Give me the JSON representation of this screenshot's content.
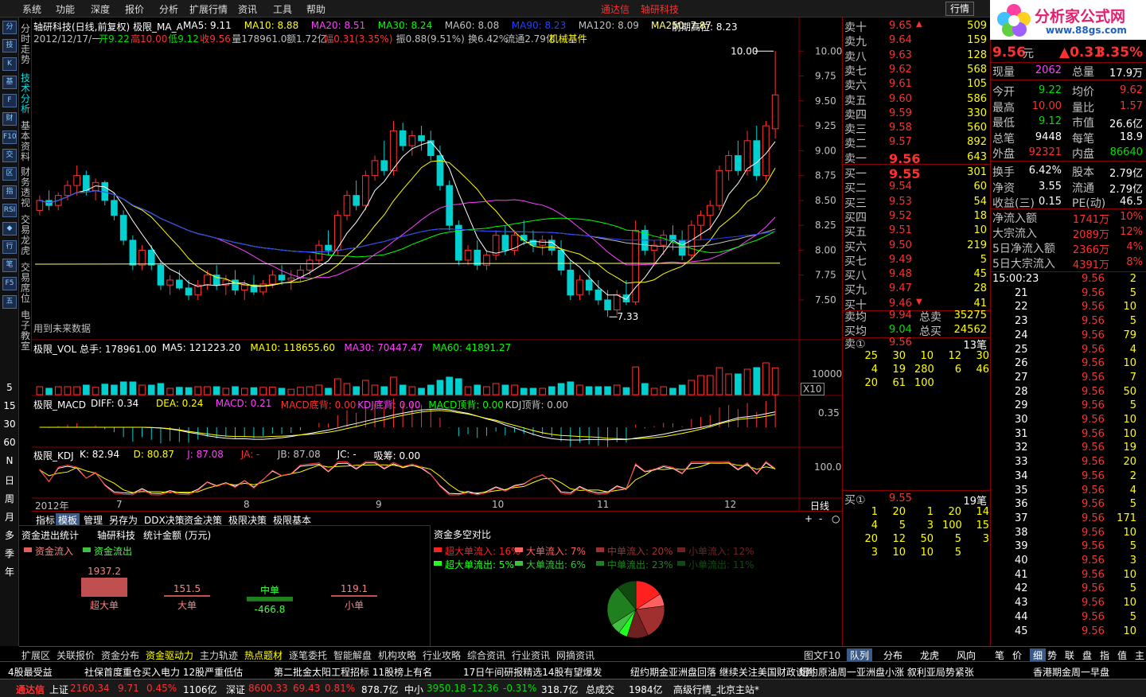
{
  "menu": [
    "系统",
    "功能",
    "深度",
    "报价",
    "分析",
    "扩展行情",
    "资讯",
    "工具",
    "帮助"
  ],
  "center_title": {
    "app": "通达信",
    "stock": "轴研科技"
  },
  "quote_button": "行情",
  "logo": {
    "main": "分析家公式网",
    "sub": "www.88gs.com"
  },
  "left_icons": [
    "分",
    "技",
    "K",
    "基",
    "F",
    "财",
    "F10",
    "交",
    "区",
    "指",
    "RSI",
    "◆",
    "行",
    "笔",
    "F5",
    "五"
  ],
  "left_periods": [
    "5",
    "15",
    "30",
    "60",
    "N",
    "日",
    "周",
    "月",
    "多",
    "季",
    "年"
  ],
  "vertical_tabs": [
    {
      "label": "分时走势",
      "active": false
    },
    {
      "label": "技术分析",
      "active": true
    },
    {
      "label": "基本资料",
      "active": false
    },
    {
      "label": "财务透视",
      "active": false
    },
    {
      "label": "交易龙虎",
      "active": false
    },
    {
      "label": "交易席位",
      "active": false
    },
    {
      "label": "电子教室",
      "active": false
    }
  ],
  "main_chart": {
    "title": "轴研科技(日线,前复权)",
    "indicator": "极限_MA_A",
    "ma": [
      {
        "label": "MA5: 9.11",
        "color": "#ffffff"
      },
      {
        "label": "MA10: 8.88",
        "color": "#ffff00"
      },
      {
        "label": "MA20: 8.51",
        "color": "#ff40ff"
      },
      {
        "label": "MA30: 8.24",
        "color": "#00ff00"
      },
      {
        "label": "MA60: 8.08",
        "color": "#c0c0c0"
      },
      {
        "label": "MA90: 8.23",
        "color": "#2040ff"
      },
      {
        "label": "MA120: 8.09",
        "color": "#c0c0c0"
      },
      {
        "label": "MA250: 7.87",
        "color": "#ffff80"
      }
    ],
    "prev_high": "前期高位: 8.23",
    "info_date": "2012/12/17/一",
    "info_items": [
      {
        "t": "开9.22",
        "c": "#00e000"
      },
      {
        "t": "高10.00",
        "c": "#ff3030"
      },
      {
        "t": "低9.12",
        "c": "#00e000"
      },
      {
        "t": "收9.56",
        "c": "#ff3030"
      },
      {
        "t": "量178961.0",
        "c": "#c0c0c0"
      },
      {
        "t": "额1.72亿",
        "c": "#c0c0c0"
      },
      {
        "t": "幅0.31(3.35%)",
        "c": "#ff3030"
      },
      {
        "t": "振0.88(9.51%)",
        "c": "#c0c0c0"
      },
      {
        "t": "换6.42%",
        "c": "#c0c0c0"
      },
      {
        "t": "流通2.79亿",
        "c": "#c0c0c0"
      },
      {
        "t": "机械基件",
        "c": "#ffff00"
      }
    ],
    "price_ticks": [
      "10.00",
      "9.75",
      "9.50",
      "9.25",
      "9.00",
      "8.75",
      "8.50",
      "8.25",
      "8.00",
      "7.75",
      "7.50"
    ],
    "high_label": "10.00",
    "low_label": "7.33",
    "future_label": "用到未来数据"
  },
  "volume_chart": {
    "indicator": "极限_VOL",
    "items": [
      {
        "t": "总手: 178961.00",
        "c": "#ffffff"
      },
      {
        "t": "MA5: 121223.20",
        "c": "#ffffff"
      },
      {
        "t": "MA10: 118655.60",
        "c": "#ffff00"
      },
      {
        "t": "MA30: 70447.47",
        "c": "#ff40ff"
      },
      {
        "t": "MA60: 41891.27",
        "c": "#00ff00"
      }
    ],
    "tick": "10000",
    "scale": "X10"
  },
  "macd_chart": {
    "indicator": "极限_MACD",
    "items": [
      {
        "t": "DIFF: 0.34",
        "c": "#ffffff"
      },
      {
        "t": "DEA: 0.24",
        "c": "#ffff00"
      },
      {
        "t": "MACD: 0.21",
        "c": "#ff40ff"
      },
      {
        "t": "MACD底背: 0.00",
        "c": "#ff3030"
      },
      {
        "t": "KDJ底背: 0.00",
        "c": "#ff40ff"
      },
      {
        "t": "MACD顶背: 0.00",
        "c": "#00ff00"
      },
      {
        "t": "KDJ顶背: 0.00",
        "c": "#c0c0c0"
      }
    ],
    "tick": "0.35"
  },
  "kdj_chart": {
    "indicator": "极限_KDJ",
    "items": [
      {
        "t": "K: 82.94",
        "c": "#ffffff"
      },
      {
        "t": "D: 80.87",
        "c": "#ffff00"
      },
      {
        "t": "J: 87.08",
        "c": "#ff40ff"
      },
      {
        "t": "JA: -",
        "c": "#ff3030"
      },
      {
        "t": "JB: 87.08",
        "c": "#c0c0c0"
      },
      {
        "t": "JC: -",
        "c": "#ffffff"
      },
      {
        "t": "吸筹: 0.00",
        "c": "#ffffff"
      }
    ],
    "tick": "100.0"
  },
  "x_axis": [
    "2012年",
    "7",
    "8",
    "9",
    "10",
    "11",
    "12"
  ],
  "period_label": "日线",
  "panel_tabs": [
    "指标",
    "模板",
    "管理",
    "另存为",
    "DDX决策",
    "资金决策",
    "极限决策",
    "极限基本"
  ],
  "flow": {
    "title": "资金进出统计",
    "stock": "轴研科技",
    "unit": "统计金额 (万元)",
    "legend_in": "资金流入",
    "legend_out": "资金流出",
    "bars": [
      {
        "name": "超大单",
        "value": "1937.2",
        "amount": 1937.2,
        "dir": "in"
      },
      {
        "name": "大单",
        "value": "151.5",
        "amount": 151.5,
        "dir": "in"
      },
      {
        "name": "中单",
        "value": "-466.8",
        "amount": -466.8,
        "dir": "out"
      },
      {
        "name": "小单",
        "value": "119.1",
        "amount": 119.1,
        "dir": "in"
      }
    ]
  },
  "distribution": {
    "title": "资金多空对比",
    "legend": [
      {
        "t": "超大单流入: 16%",
        "c": "#ff2020",
        "v": 16
      },
      {
        "t": "大单流入:  7%",
        "c": "#ff6060",
        "v": 7
      },
      {
        "t": "中单流入: 20%",
        "c": "#a03030",
        "v": 20
      },
      {
        "t": "小单流入: 12%",
        "c": "#702020",
        "v": 12
      },
      {
        "t": "超大单流出:  5%",
        "c": "#20ff20",
        "v": 5
      },
      {
        "t": "大单流出:  6%",
        "c": "#40c040",
        "v": 6
      },
      {
        "t": "中单流出: 23%",
        "c": "#208020",
        "v": 23
      },
      {
        "t": "小单流出: 11%",
        "c": "#104a10",
        "v": 11
      }
    ]
  },
  "bottom_tabs": [
    "扩展区",
    "关联报价",
    "资金分布",
    "资金驱动力",
    "主力轨迹",
    "热点题材",
    "逐笔委托",
    "智能解盘",
    "机构攻略",
    "行业攻略",
    "综合资讯",
    "行业资讯",
    "网摘资讯",
    "图文F10"
  ],
  "quote": {
    "sells": [
      {
        "l": "卖十",
        "p": "9.65",
        "v": "509",
        "mark": "▲"
      },
      {
        "l": "卖九",
        "p": "9.64",
        "v": "159",
        "mark": ""
      },
      {
        "l": "卖八",
        "p": "9.63",
        "v": "128",
        "mark": ""
      },
      {
        "l": "卖七",
        "p": "9.62",
        "v": "568",
        "mark": ""
      },
      {
        "l": "卖六",
        "p": "9.61",
        "v": "105",
        "mark": ""
      },
      {
        "l": "卖五",
        "p": "9.60",
        "v": "586",
        "mark": ""
      },
      {
        "l": "卖四",
        "p": "9.59",
        "v": "330",
        "mark": ""
      },
      {
        "l": "卖三",
        "p": "9.58",
        "v": "560",
        "mark": ""
      },
      {
        "l": "卖二",
        "p": "9.57",
        "v": "892",
        "mark": ""
      },
      {
        "l": "卖一",
        "p": "9.56",
        "v": "643",
        "mark": ""
      }
    ],
    "buys": [
      {
        "l": "买一",
        "p": "9.55",
        "v": "301",
        "mark": ""
      },
      {
        "l": "买二",
        "p": "9.54",
        "v": "60",
        "mark": ""
      },
      {
        "l": "买三",
        "p": "9.53",
        "v": "54",
        "mark": ""
      },
      {
        "l": "买四",
        "p": "9.52",
        "v": "18",
        "mark": ""
      },
      {
        "l": "买五",
        "p": "9.51",
        "v": "10",
        "mark": ""
      },
      {
        "l": "买六",
        "p": "9.50",
        "v": "219",
        "mark": ""
      },
      {
        "l": "买七",
        "p": "9.49",
        "v": "5",
        "mark": ""
      },
      {
        "l": "买八",
        "p": "9.48",
        "v": "45",
        "mark": ""
      },
      {
        "l": "买九",
        "p": "9.47",
        "v": "28",
        "mark": ""
      },
      {
        "l": "买十",
        "p": "9.46",
        "v": "41",
        "mark": "▼"
      }
    ],
    "avg": [
      {
        "l": "卖均",
        "p": "9.94",
        "l2": "总卖",
        "v": "35275"
      },
      {
        "l": "买均",
        "p": "9.04",
        "l2": "总买",
        "v": "24562"
      }
    ],
    "sell_queue": {
      "label": "卖①",
      "price": "9.56",
      "count": "13笔",
      "rows": [
        [
          "25",
          "30",
          "10",
          "12",
          "30"
        ],
        [
          "4",
          "19",
          "280",
          "6",
          "46"
        ],
        [
          "20",
          "61",
          "100",
          "",
          ""
        ]
      ]
    },
    "buy_queue": {
      "label": "买①",
      "price": "9.55",
      "count": "19笔",
      "rows": [
        [
          "1",
          "20",
          "1",
          "20",
          "14"
        ],
        [
          "4",
          "5",
          "3",
          "100",
          "15"
        ],
        [
          "20",
          "12",
          "50",
          "5",
          "3"
        ],
        [
          "3",
          "10",
          "10",
          "5",
          ""
        ]
      ]
    }
  },
  "stats": {
    "price": "9.56",
    "unit": "元",
    "change": "▲0.31",
    "pct": "3.35%",
    "rows": [
      {
        "l": "现量",
        "v": "2062",
        "l2": "总量",
        "v2": "17.9万",
        "c": "#ff40ff",
        "c2": "#ffffff"
      },
      {
        "l": "今开",
        "v": "9.22",
        "l2": "均价",
        "v2": "9.62",
        "c": "#00e000",
        "c2": "#ff3030"
      },
      {
        "l": "最高",
        "v": "10.00",
        "l2": "量比",
        "v2": "1.57",
        "c": "#ff3030",
        "c2": "#ff3030"
      },
      {
        "l": "最低",
        "v": "9.12",
        "l2": "市值",
        "v2": "26.6亿",
        "c": "#00e000",
        "c2": "#ffffff"
      },
      {
        "l": "总笔",
        "v": "9448",
        "l2": "每笔",
        "v2": "18.9",
        "c": "#ffffff",
        "c2": "#ffffff"
      },
      {
        "l": "外盘",
        "v": "92321",
        "l2": "内盘",
        "v2": "86640",
        "c": "#ff3030",
        "c2": "#00e000"
      },
      {
        "l": "换手",
        "v": "6.42%",
        "l2": "股本",
        "v2": "2.79亿",
        "c": "#ffffff",
        "c2": "#ffffff"
      },
      {
        "l": "净资",
        "v": "3.55",
        "l2": "流通",
        "v2": "2.79亿",
        "c": "#ffffff",
        "c2": "#ffffff"
      },
      {
        "l": "收益(三)",
        "v": "0.15",
        "l2": "PE(动)",
        "v2": "46.5",
        "c": "#ffffff",
        "c2": "#ffffff"
      }
    ],
    "netflow": [
      {
        "l": "净流入额",
        "v": "1741万",
        "p": "10%"
      },
      {
        "l": "大宗流入",
        "v": "2089万",
        "p": "12%"
      },
      {
        "l": "5日净流入额",
        "v": "2366万",
        "p": "4%"
      },
      {
        "l": "5日大宗流入",
        "v": "4391万",
        "p": "8%"
      }
    ]
  },
  "ticks": [
    {
      "t": "15:00:23",
      "p": "9.56",
      "v": "2"
    },
    {
      "t": "21",
      "p": "9.56",
      "v": "5"
    },
    {
      "t": "22",
      "p": "9.56",
      "v": "10"
    },
    {
      "t": "23",
      "p": "9.56",
      "v": "5"
    },
    {
      "t": "24",
      "p": "9.56",
      "v": "79"
    },
    {
      "t": "25",
      "p": "9.56",
      "v": "4"
    },
    {
      "t": "26",
      "p": "9.56",
      "v": "10"
    },
    {
      "t": "27",
      "p": "9.56",
      "v": "7"
    },
    {
      "t": "28",
      "p": "9.56",
      "v": "50"
    },
    {
      "t": "29",
      "p": "9.56",
      "v": "5"
    },
    {
      "t": "30",
      "p": "9.56",
      "v": "10"
    },
    {
      "t": "31",
      "p": "9.56",
      "v": "10"
    },
    {
      "t": "32",
      "p": "9.56",
      "v": "19"
    },
    {
      "t": "33",
      "p": "9.56",
      "v": "20"
    },
    {
      "t": "34",
      "p": "9.56",
      "v": "2"
    },
    {
      "t": "35",
      "p": "9.56",
      "v": "4"
    },
    {
      "t": "36",
      "p": "9.56",
      "v": "5"
    },
    {
      "t": "37",
      "p": "9.56",
      "v": "171"
    },
    {
      "t": "38",
      "p": "9.56",
      "v": "10"
    },
    {
      "t": "39",
      "p": "9.56",
      "v": "5"
    },
    {
      "t": "40",
      "p": "9.56",
      "v": "3"
    },
    {
      "t": "41",
      "p": "9.56",
      "v": "10"
    },
    {
      "t": "42",
      "p": "9.56",
      "v": "5"
    },
    {
      "t": "43",
      "p": "9.56",
      "v": "10"
    },
    {
      "t": "44",
      "p": "9.56",
      "v": "5"
    },
    {
      "t": "45",
      "p": "9.56",
      "v": "10"
    }
  ],
  "quote_tabs": [
    "队列",
    "分布",
    "龙虎",
    "风向"
  ],
  "tick_tabs": [
    "笔",
    "价",
    "细",
    "势",
    "联",
    "盘",
    "指",
    "值",
    "主"
  ],
  "ticker": [
    "4股最受益",
    "社保首度重仓买入电力 12股严重低估",
    "第二批金太阳工程招标 11股榜上有名",
    "17日午间研报精选14股有望爆发",
    "纽约期金亚洲盘回落 继续关注美国财政谈判",
    "纽约原油周一亚洲盘小涨 叙利亚局势紧张",
    "香港期金周一早盘"
  ],
  "status": {
    "app": "通达信",
    "items": [
      {
        "t": "上证",
        "c": "#ffffff"
      },
      {
        "t": "2160.34",
        "c": "#ff3030"
      },
      {
        "t": "9.71",
        "c": "#ff3030"
      },
      {
        "t": "0.45%",
        "c": "#ff3030"
      },
      {
        "t": "1106亿",
        "c": "#ffffff"
      },
      {
        "t": "深证",
        "c": "#ffffff"
      },
      {
        "t": "8600.33",
        "c": "#ff3030"
      },
      {
        "t": "69.43",
        "c": "#ff3030"
      },
      {
        "t": "0.81%",
        "c": "#ff3030"
      },
      {
        "t": "878.7亿",
        "c": "#ffffff"
      },
      {
        "t": "中小",
        "c": "#ffffff"
      },
      {
        "t": "3950.18",
        "c": "#00e000"
      },
      {
        "t": "-12.36",
        "c": "#00e000"
      },
      {
        "t": "-0.31%",
        "c": "#00e000"
      },
      {
        "t": "318.7亿",
        "c": "#ffffff"
      },
      {
        "t": "总成交",
        "c": "#ffffff"
      },
      {
        "t": "1984亿",
        "c": "#ffffff"
      },
      {
        "t": "高级行情_北京主站*",
        "c": "#ffffff"
      }
    ]
  },
  "chart_data": {
    "type": "candlestick",
    "title": "轴研科技(日线,前复权)",
    "ylim": [
      7.3,
      10.05
    ],
    "ohlc": [
      [
        8.4,
        8.55,
        8.35,
        8.5
      ],
      [
        8.5,
        8.6,
        8.4,
        8.45
      ],
      [
        8.45,
        8.58,
        8.4,
        8.55
      ],
      [
        8.55,
        8.7,
        8.5,
        8.65
      ],
      [
        8.65,
        8.85,
        8.55,
        8.75
      ],
      [
        8.75,
        8.8,
        8.55,
        8.6
      ],
      [
        8.6,
        8.72,
        8.5,
        8.68
      ],
      [
        8.68,
        8.7,
        8.45,
        8.5
      ],
      [
        8.5,
        8.55,
        8.3,
        8.35
      ],
      [
        8.35,
        8.4,
        8.05,
        8.1
      ],
      [
        8.1,
        8.15,
        7.8,
        7.85
      ],
      [
        7.85,
        8.05,
        7.8,
        8.0
      ],
      [
        8.0,
        8.05,
        7.8,
        7.85
      ],
      [
        7.85,
        7.9,
        7.6,
        7.65
      ],
      [
        7.65,
        7.75,
        7.55,
        7.7
      ],
      [
        7.7,
        7.8,
        7.6,
        7.62
      ],
      [
        7.62,
        7.7,
        7.5,
        7.55
      ],
      [
        7.55,
        7.7,
        7.5,
        7.65
      ],
      [
        7.65,
        7.8,
        7.6,
        7.75
      ],
      [
        7.75,
        7.85,
        7.6,
        7.65
      ],
      [
        7.65,
        7.75,
        7.55,
        7.7
      ],
      [
        7.7,
        7.8,
        7.55,
        7.6
      ],
      [
        7.6,
        7.7,
        7.5,
        7.65
      ],
      [
        7.65,
        7.75,
        7.55,
        7.58
      ],
      [
        7.58,
        7.7,
        7.55,
        7.66
      ],
      [
        7.66,
        7.8,
        7.62,
        7.75
      ],
      [
        7.75,
        7.85,
        7.65,
        7.7
      ],
      [
        7.7,
        7.8,
        7.6,
        7.72
      ],
      [
        7.72,
        7.85,
        7.68,
        7.8
      ],
      [
        7.8,
        7.95,
        7.75,
        7.9
      ],
      [
        7.9,
        8.1,
        7.85,
        8.05
      ],
      [
        8.05,
        8.2,
        7.95,
        8.0
      ],
      [
        8.0,
        8.4,
        7.95,
        8.35
      ],
      [
        8.35,
        8.6,
        8.3,
        8.55
      ],
      [
        8.55,
        8.7,
        8.4,
        8.45
      ],
      [
        8.45,
        8.8,
        8.4,
        8.75
      ],
      [
        8.75,
        8.95,
        8.7,
        8.9
      ],
      [
        8.9,
        9.1,
        8.75,
        8.8
      ],
      [
        8.8,
        9.3,
        8.75,
        9.2
      ],
      [
        9.2,
        9.28,
        9.0,
        9.05
      ],
      [
        9.05,
        9.2,
        8.95,
        9.15
      ],
      [
        9.15,
        9.25,
        9.0,
        9.1
      ],
      [
        9.1,
        9.2,
        8.9,
        8.95
      ],
      [
        8.95,
        9.05,
        8.6,
        8.65
      ],
      [
        8.65,
        8.7,
        8.2,
        8.25
      ],
      [
        8.25,
        8.3,
        7.85,
        7.9
      ],
      [
        7.9,
        8.05,
        7.85,
        8.0
      ],
      [
        8.0,
        8.1,
        7.8,
        7.85
      ],
      [
        7.85,
        8.0,
        7.8,
        7.95
      ],
      [
        7.95,
        8.2,
        7.9,
        8.15
      ],
      [
        8.15,
        8.25,
        7.95,
        8.0
      ],
      [
        8.0,
        8.2,
        7.95,
        8.15
      ],
      [
        8.15,
        8.3,
        8.05,
        8.1
      ],
      [
        8.1,
        8.2,
        7.98,
        8.05
      ],
      [
        8.05,
        8.15,
        7.95,
        8.1
      ],
      [
        8.1,
        8.15,
        7.95,
        8.0
      ],
      [
        8.0,
        8.1,
        7.75,
        7.8
      ],
      [
        7.8,
        7.9,
        7.5,
        7.55
      ],
      [
        7.55,
        7.75,
        7.5,
        7.7
      ],
      [
        7.7,
        7.8,
        7.55,
        7.6
      ],
      [
        7.6,
        7.7,
        7.45,
        7.5
      ],
      [
        7.5,
        7.6,
        7.33,
        7.4
      ],
      [
        7.4,
        7.6,
        7.35,
        7.55
      ],
      [
        7.55,
        7.7,
        7.45,
        7.48
      ],
      [
        7.48,
        8.3,
        7.45,
        8.2
      ],
      [
        8.2,
        8.25,
        7.95,
        8.0
      ],
      [
        8.0,
        8.1,
        7.85,
        8.05
      ],
      [
        8.05,
        8.2,
        7.95,
        8.15
      ],
      [
        8.15,
        8.25,
        8.0,
        8.1
      ],
      [
        8.1,
        8.2,
        7.9,
        7.95
      ],
      [
        7.95,
        8.3,
        7.9,
        8.25
      ],
      [
        8.25,
        8.4,
        8.1,
        8.35
      ],
      [
        8.35,
        8.5,
        8.2,
        8.45
      ],
      [
        8.45,
        8.85,
        8.4,
        8.8
      ],
      [
        8.8,
        9.0,
        8.7,
        8.95
      ],
      [
        8.95,
        9.1,
        8.75,
        8.8
      ],
      [
        8.8,
        9.2,
        8.75,
        9.1
      ],
      [
        9.1,
        9.25,
        8.7,
        8.75
      ],
      [
        8.75,
        9.3,
        8.7,
        9.25
      ],
      [
        9.22,
        10.0,
        9.12,
        9.56
      ]
    ]
  }
}
